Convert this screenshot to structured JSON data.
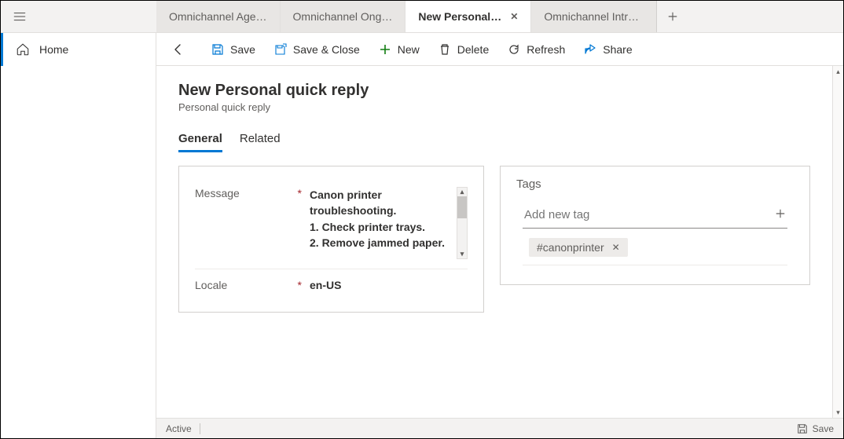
{
  "header": {
    "tabs": [
      {
        "label": "Omnichannel Age…",
        "active": false
      },
      {
        "label": "Omnichannel Ong…",
        "active": false
      },
      {
        "label": "New Personal quick reply",
        "active": true,
        "closeable": true
      },
      {
        "label": "Omnichannel Intra…",
        "active": false
      }
    ]
  },
  "sidebar": {
    "home": "Home"
  },
  "cmdbar": {
    "save": "Save",
    "save_close": "Save & Close",
    "new": "New",
    "delete": "Delete",
    "refresh": "Refresh",
    "share": "Share"
  },
  "page": {
    "title": "New Personal quick reply",
    "subtitle": "Personal quick reply"
  },
  "form_tabs": {
    "general": "General",
    "related": "Related"
  },
  "fields": {
    "message_label": "Message",
    "message_value": "Canon printer troubleshooting.\n1. Check printer trays.\n2. Remove jammed paper.",
    "locale_label": "Locale",
    "locale_value": "en-US"
  },
  "tags": {
    "title": "Tags",
    "placeholder": "Add new tag",
    "items": [
      "#canonprinter"
    ]
  },
  "statusbar": {
    "status": "Active",
    "save": "Save"
  }
}
